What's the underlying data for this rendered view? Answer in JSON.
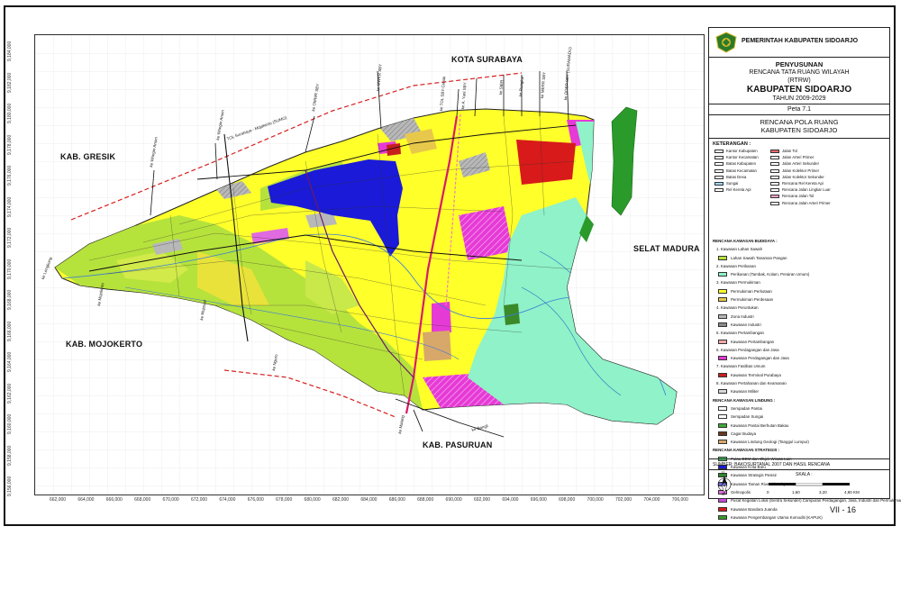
{
  "regions": {
    "surabaya": "KOTA SURABAYA",
    "gresik": "KAB. GRESIK",
    "mojokerto": "KAB. MOJOKERTO",
    "pasuruan": "KAB. PASURUAN",
    "madura": "SELAT MADURA"
  },
  "roads": {
    "sumo": "TOL Surabaya - Mojokerto (SUMO)",
    "wringin": "ke Wringin Anom",
    "wringin2": "ke Wringin Anom",
    "omwr": "ke OMWR SBY",
    "mwkr": "ke MWKR SBY",
    "tol_sby": "ke TOL SBY-Gresik",
    "ayani": "ke A. Yani SBY",
    "szer": "ke SIER",
    "rungkut": "ke Rungkut",
    "merr": "ke MERR SBY",
    "oder": "ke ODER SBY (SURAMADU)",
    "lengkong": "ke Lengkong",
    "mojokerto": "ke Mojokerto",
    "mojosari": "ke Mojosari",
    "ngoro": "ke Ngoro",
    "malang": "ke Malang",
    "bangil": "ke Bangil"
  },
  "x_ticks": [
    "662,000",
    "664,000",
    "666,000",
    "668,000",
    "670,000",
    "672,000",
    "674,000",
    "676,000",
    "678,000",
    "680,000",
    "682,000",
    "684,000",
    "686,000",
    "688,000",
    "690,000",
    "692,000",
    "694,000",
    "696,000",
    "698,000",
    "700,000",
    "702,000",
    "704,000",
    "706,000"
  ],
  "y_ticks": [
    "9,184,000",
    "9,182,000",
    "9,180,000",
    "9,178,000",
    "9,176,000",
    "9,174,000",
    "9,172,000",
    "9,170,000",
    "9,168,000",
    "9,166,000",
    "9,164,000",
    "9,162,000",
    "9,160,000",
    "9,158,000",
    "9,156,000"
  ],
  "panel": {
    "gov": "PEMERINTAH KABUPATEN SIDOARJO",
    "title1": "PENYUSUNAN",
    "title2": "RENCANA TATA RUANG WILAYAH",
    "title3": "(RTRW)",
    "title4": "KABUPATEN SIDOARJO",
    "title5": "TAHUN 2009-2029",
    "peta": "Peta 7.1",
    "rencana1": "RENCANA POLA RUANG",
    "rencana2": "KABUPATEN SIDOARJO",
    "keterangan": "KETERANGAN :",
    "sumber": "SUMBER:   BAKOSURTANAL 2007 DAN HASIL RENCANA",
    "skala": "SKALA :",
    "scale_labels": [
      "0",
      "1,60",
      "3,20",
      "4,80 KM"
    ],
    "north": "U",
    "south": "S"
  },
  "basic_legend_left": [
    {
      "label": "Kantor Kabupaten",
      "color": "#ffffff"
    },
    {
      "label": "Kantor Kecamatan",
      "color": "#ffffff"
    },
    {
      "label": "Batas Kabupaten",
      "color": "#ffffff"
    },
    {
      "label": "Batas Kecamatan",
      "color": "#ffffff"
    },
    {
      "label": "Batas Desa",
      "color": "#ffffff"
    },
    {
      "label": "Sungai",
      "color": "#9fd8ff"
    },
    {
      "label": "Rel Kereta Api",
      "color": "#ffffff"
    }
  ],
  "basic_legend_right": [
    {
      "label": "Jalan Tol",
      "color": "#f06a6a"
    },
    {
      "label": "Jalan Arteri Primer",
      "color": "#ffffff"
    },
    {
      "label": "Jalan Arteri Sekunder",
      "color": "#ffffff"
    },
    {
      "label": "Jalan Kolektor Primer",
      "color": "#ffffff"
    },
    {
      "label": "Jalan Kolektor Sekunder",
      "color": "#ffffff"
    },
    {
      "label": "Rencana Rel Kereta Api",
      "color": "#ffffff"
    },
    {
      "label": "Rencana Jalan Lingkar Luar",
      "color": "#ffffff"
    },
    {
      "label": "Rencana Jalan Tol",
      "color": "#f7a0c8"
    },
    {
      "label": "Rencana Jalan Arteri Primer",
      "color": "#ffffff"
    }
  ],
  "legend": [
    {
      "kind": "head",
      "label": "RENCANA KAWASAN BUDIDAYA :"
    },
    {
      "kind": "sub",
      "label": "1. Kawasan Lahan Sawah"
    },
    {
      "kind": "item",
      "label": "Lahan Sawah Tanaman Pangan",
      "color": "#b6e23c"
    },
    {
      "kind": "sub",
      "label": "2. Kawasan Perikanan"
    },
    {
      "kind": "item",
      "label": "Perikanan (Tambak, Kolam, Perairan Umum)",
      "color": "#8ff2c8"
    },
    {
      "kind": "sub",
      "label": "3. Kawasan Permukiman"
    },
    {
      "kind": "item",
      "label": "Permukiman Perkotaan",
      "color": "#ffff2a"
    },
    {
      "kind": "item",
      "label": "Permukiman Perdesaan",
      "color": "#e8c84a"
    },
    {
      "kind": "sub",
      "label": "4. Kawasan Peruntukan"
    },
    {
      "kind": "item",
      "label": "Zona Industri",
      "color": "#b8b8b8"
    },
    {
      "kind": "item",
      "label": "Kawasan Industri",
      "color": "#8a8a8a"
    },
    {
      "kind": "sub",
      "label": "5. Kawasan Pertambangan"
    },
    {
      "kind": "item",
      "label": "Kawasan Pertambangan",
      "color": "#f7a8a8"
    },
    {
      "kind": "sub",
      "label": "6. Kawasan Perdagangan dan Jasa"
    },
    {
      "kind": "item",
      "label": "Kawasan Perdagangan dan Jasa",
      "color": "#e63ad6"
    },
    {
      "kind": "sub",
      "label": "7. Kawasan Fasilitas Umum"
    },
    {
      "kind": "item",
      "label": "Kawasan Terminal Purabaya",
      "color": "#c81e1e"
    },
    {
      "kind": "sub",
      "label": "8. Kawasan Pertahanan dan Keamanan"
    },
    {
      "kind": "item",
      "label": "Kawasan Militer",
      "color": "#d8d8d8"
    },
    {
      "kind": "head",
      "label": "RENCANA KAWASAN LINDUNG :"
    },
    {
      "kind": "item",
      "label": "Sempadan Pantai",
      "color": "#ffffff"
    },
    {
      "kind": "item",
      "label": "Sempadan Sungai",
      "color": "#ffffff"
    },
    {
      "kind": "item",
      "label": "Kawasan Pantai Berhutan Bakau",
      "color": "#3fa83c"
    },
    {
      "kind": "item",
      "label": "Cagar Budaya",
      "color": "#6a3a1e"
    },
    {
      "kind": "item",
      "label": "Kawasan Lindung Geologi (Tanggul Lumpur)",
      "color": "#d8a86a"
    },
    {
      "kind": "head",
      "label": "RENCANA KAWASAN STRATEGIS :"
    },
    {
      "kind": "item",
      "label": "Pulau DEM dan Objek Wisata Lain",
      "color": "#4ad86a"
    },
    {
      "kind": "item",
      "label": "Kawasan Kota Baru",
      "color": "#1a1ad8"
    },
    {
      "kind": "item",
      "label": "Kawasan Strategis Pesisir",
      "color": "#2a8a2a"
    },
    {
      "kind": "item",
      "label": "Kawasan Taman Riverside City",
      "color": "#6a6ad8"
    },
    {
      "kind": "item",
      "label": "Gelmopolis",
      "color": "#e06ae0"
    },
    {
      "kind": "item",
      "label": "Pusat Kegiatan Lokal (Sentra Sekunder) Campuran Perdagangan, Jasa, Industri dan Permukiman",
      "color": "#c84ad8"
    },
    {
      "kind": "item",
      "label": "Kawasan Bandara Juanda",
      "color": "#d81a1a"
    },
    {
      "kind": "item",
      "label": "Kawasan Pengembangan Utama Komoditi (KAPUK)",
      "color": "#3a9a2a"
    }
  ],
  "page": "VII - 16"
}
